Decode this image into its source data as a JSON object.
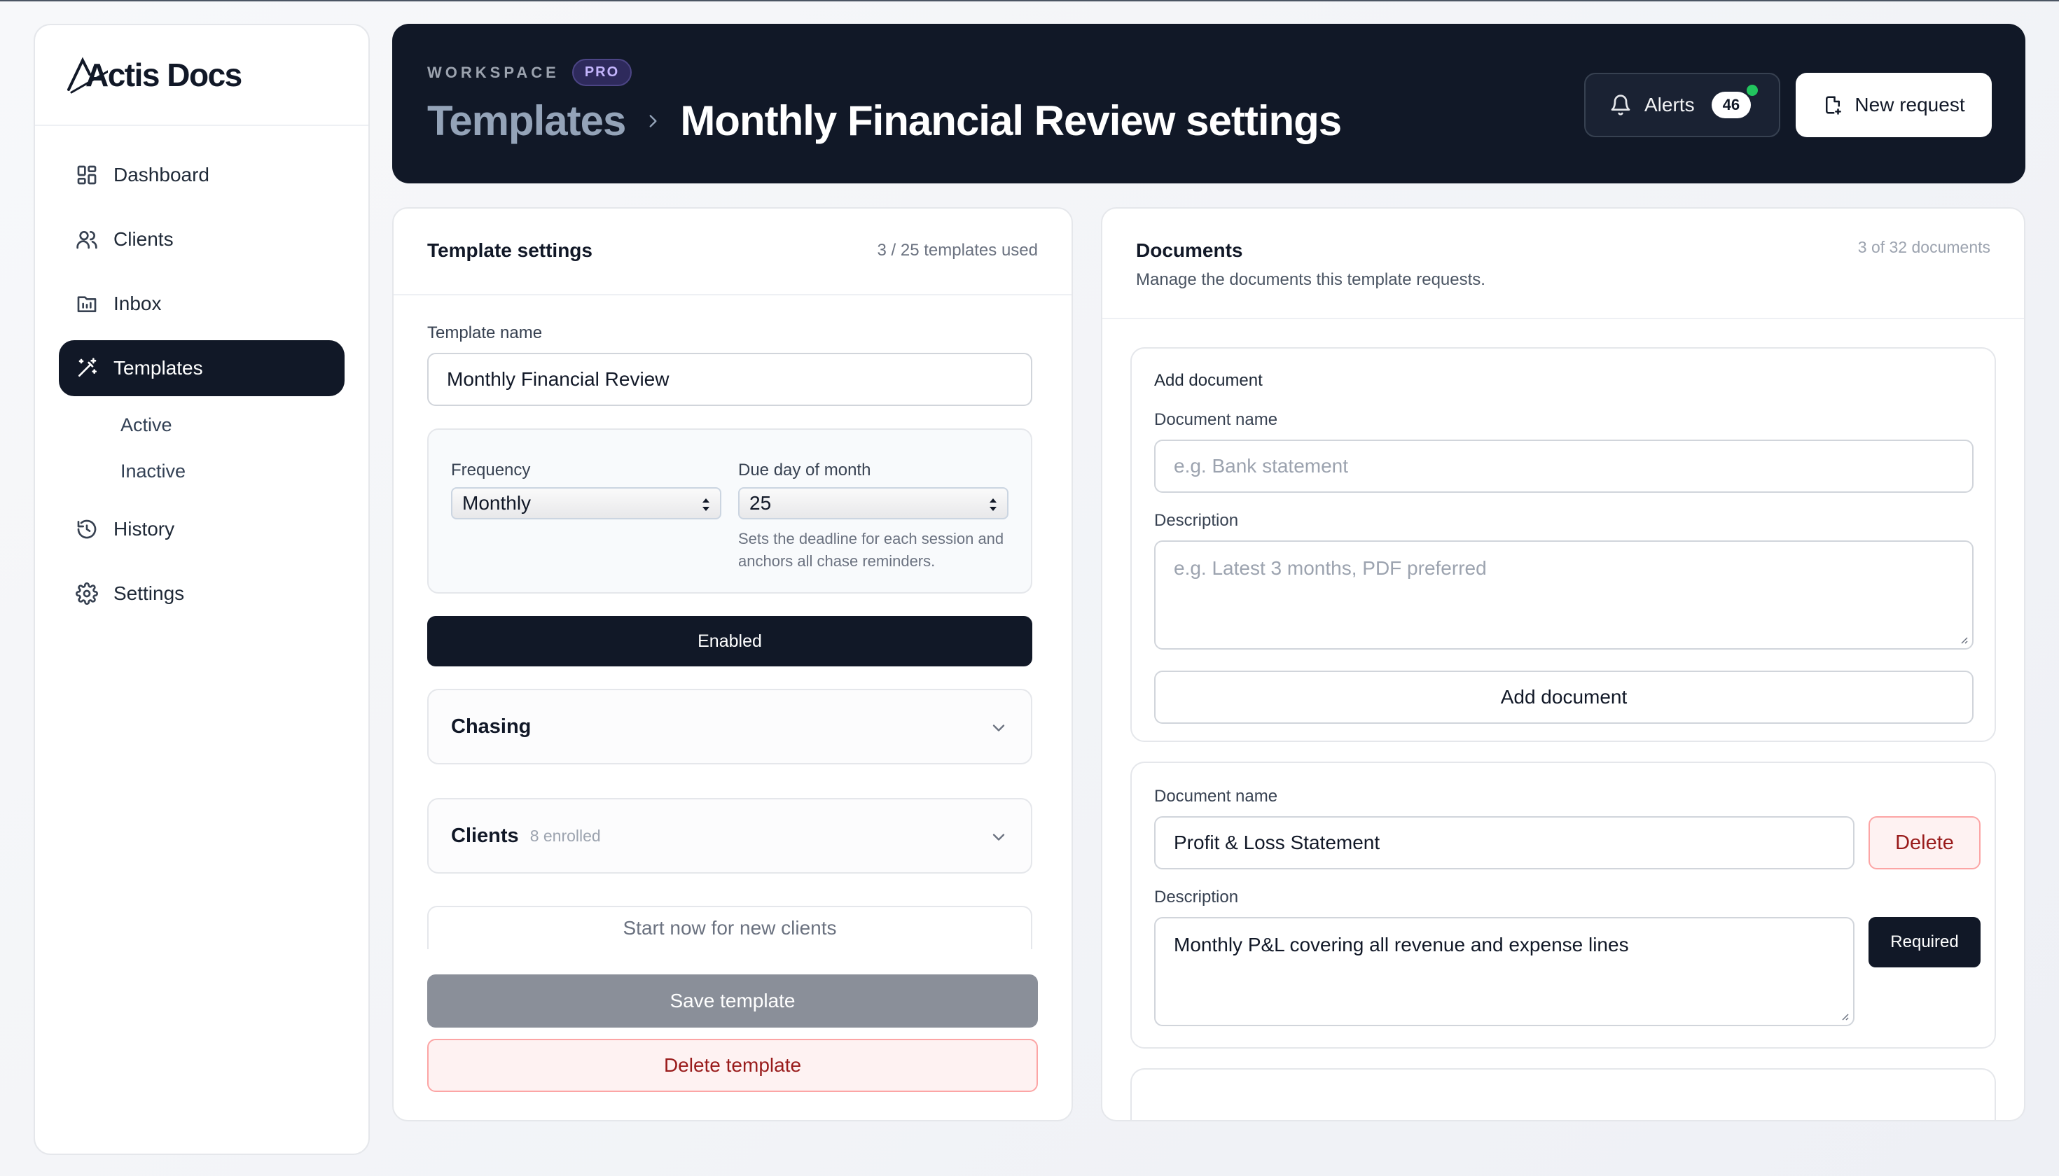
{
  "brand": {
    "name": "Actis Docs"
  },
  "sidebar": {
    "items": [
      {
        "label": "Dashboard",
        "icon": "dashboard-icon"
      },
      {
        "label": "Clients",
        "icon": "users-icon"
      },
      {
        "label": "Inbox",
        "icon": "inbox-icon"
      },
      {
        "label": "Templates",
        "icon": "magic-wand-icon",
        "active": true
      },
      {
        "label": "History",
        "icon": "history-icon"
      },
      {
        "label": "Settings",
        "icon": "gear-icon"
      }
    ],
    "templates_sub": [
      "Active",
      "Inactive"
    ]
  },
  "header": {
    "workspace_label": "WORKSPACE",
    "plan_badge": "PRO",
    "breadcrumb_parent": "Templates",
    "breadcrumb_current": "Monthly Financial Review settings",
    "alerts_label": "Alerts",
    "alerts_count": "46",
    "new_request_label": "New request"
  },
  "template_settings": {
    "title": "Template settings",
    "usage": "3 / 25 templates used",
    "name_label": "Template name",
    "name_value": "Monthly Financial Review",
    "frequency_label": "Frequency",
    "frequency_value": "Monthly",
    "due_label": "Due day of month",
    "due_value": "25",
    "due_help": "Sets the deadline for each session and anchors all chase reminders.",
    "status_button": "Enabled",
    "chasing_title": "Chasing",
    "clients_title": "Clients",
    "clients_enrolled": "8 enrolled",
    "start_now": "Start now for new clients",
    "save_label": "Save template",
    "delete_label": "Delete template"
  },
  "documents": {
    "title": "Documents",
    "subtitle": "Manage the documents this template requests.",
    "count": "3 of 32 documents",
    "add_section": {
      "title": "Add document",
      "name_label": "Document name",
      "name_placeholder": "e.g. Bank statement",
      "desc_label": "Description",
      "desc_placeholder": "e.g. Latest 3 months, PDF preferred",
      "add_button": "Add document"
    },
    "items": [
      {
        "name_label": "Document name",
        "name": "Profit & Loss Statement",
        "delete_label": "Delete",
        "desc_label": "Description",
        "description": "Monthly P&L covering all revenue and expense lines",
        "required_label": "Required"
      }
    ]
  },
  "colors": {
    "primary_dark": "#111827",
    "danger": "#991b1b",
    "danger_bg": "#fef2f2",
    "success_dot": "#22c55e",
    "pro_badge": "#2e2a5c"
  }
}
